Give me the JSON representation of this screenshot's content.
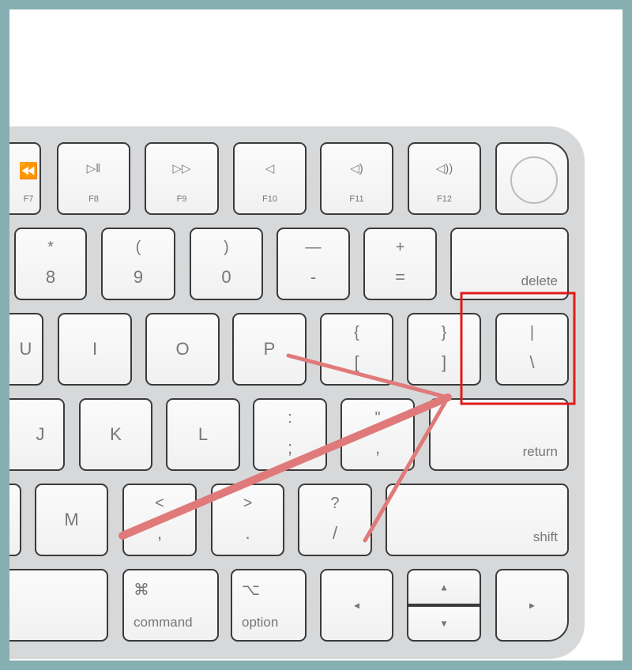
{
  "colors": {
    "frame": "#86afb2",
    "annotation": "#e07a7a",
    "highlight_box": "#e01b1b"
  },
  "keys": {
    "f7": {
      "icon": "rewind-icon",
      "glyph": "⏪",
      "label": "F7"
    },
    "f8": {
      "icon": "play-pause-icon",
      "glyph": "▷‖",
      "label": "F8"
    },
    "f9": {
      "icon": "fast-forward-icon",
      "glyph": "▷▷",
      "label": "F9"
    },
    "f10": {
      "icon": "mute-icon",
      "glyph": "◁",
      "label": "F10"
    },
    "f11": {
      "icon": "volume-down-icon",
      "glyph": "◁)",
      "label": "F11"
    },
    "f12": {
      "icon": "volume-up-icon",
      "glyph": "◁))",
      "label": "F12"
    },
    "k8": {
      "top": "*",
      "bot": "8"
    },
    "k9": {
      "top": "(",
      "bot": "9"
    },
    "k0": {
      "top": ")",
      "bot": "0"
    },
    "minus": {
      "top": "—",
      "bot": "-"
    },
    "equals": {
      "top": "+",
      "bot": "="
    },
    "delete": "delete",
    "u": "U",
    "i": "I",
    "o": "O",
    "p": "P",
    "lbracket": {
      "top": "{",
      "bot": "["
    },
    "rbracket": {
      "top": "}",
      "bot": "]"
    },
    "backslash": {
      "top": "|",
      "bot": "\\"
    },
    "j": "J",
    "k": "K",
    "l": "L",
    "semicolon": {
      "top": ":",
      "bot": ";"
    },
    "quote": {
      "top": "\"",
      "bot": ","
    },
    "return": "return",
    "m": "M",
    "comma": {
      "top": "<",
      "bot": ","
    },
    "period": {
      "top": ">",
      "bot": "."
    },
    "slash": {
      "top": "?",
      "bot": "/"
    },
    "shift": "shift",
    "command": {
      "sym": "⌘",
      "label": "command"
    },
    "option": {
      "sym": "⌥",
      "label": "option"
    },
    "left": "◂",
    "up": "▴",
    "down": "▾",
    "right": "▸"
  }
}
